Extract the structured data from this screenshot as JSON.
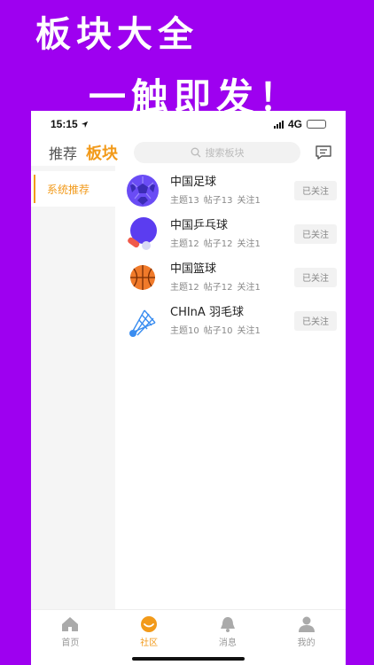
{
  "promo": {
    "line1": "板块大全",
    "line2": "一触即发！"
  },
  "status_bar": {
    "time": "15:15",
    "network": "4G"
  },
  "header": {
    "tabs": [
      {
        "label": "推荐"
      },
      {
        "label": "板块"
      }
    ],
    "search_placeholder": "搜索板块"
  },
  "sidebar": {
    "items": [
      {
        "label": "系统推荐"
      }
    ]
  },
  "boards": [
    {
      "name": "中国足球",
      "topics": "主题13",
      "posts": "帖子13",
      "follows": "关注1",
      "status": "已关注",
      "icon": "soccer-icon"
    },
    {
      "name": "中国乒乓球",
      "topics": "主题12",
      "posts": "帖子12",
      "follows": "关注1",
      "status": "已关注",
      "icon": "ping-pong-icon"
    },
    {
      "name": "中国篮球",
      "topics": "主题12",
      "posts": "帖子12",
      "follows": "关注1",
      "status": "已关注",
      "icon": "basketball-icon"
    },
    {
      "name": "CHInA 羽毛球",
      "topics": "主题10",
      "posts": "帖子10",
      "follows": "关注1",
      "status": "已关注",
      "icon": "shuttlecock-icon"
    }
  ],
  "tabbar": {
    "items": [
      {
        "label": "首页"
      },
      {
        "label": "社区"
      },
      {
        "label": "消息"
      },
      {
        "label": "我的"
      }
    ]
  },
  "colors": {
    "brand": "#f29a1a",
    "background": "#9e00f0"
  }
}
